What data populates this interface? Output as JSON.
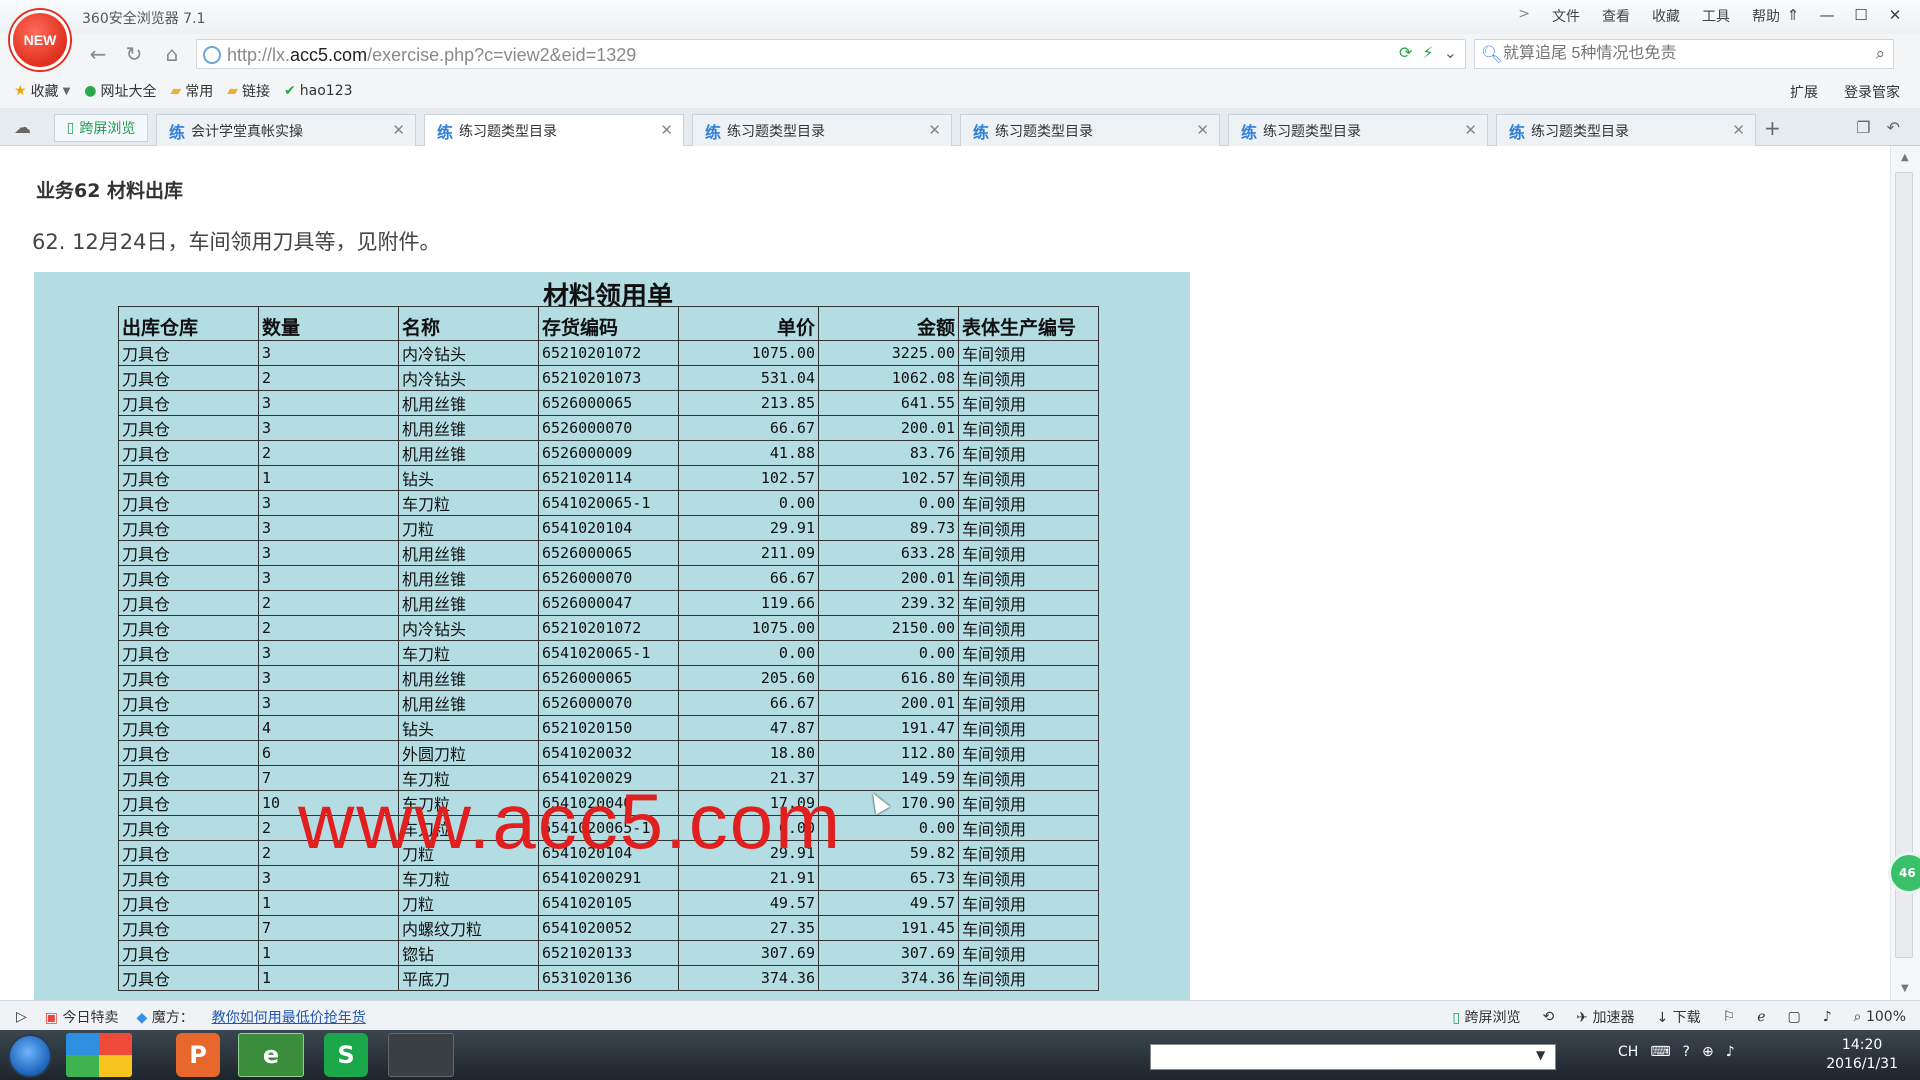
{
  "browser": {
    "logo_text": "NEW",
    "title": "360安全浏览器 7.1",
    "menu": [
      "文件",
      "查看",
      "收藏",
      "工具",
      "帮助"
    ],
    "menu_chevron": ">",
    "window_controls": [
      "⇑",
      "—",
      "☐",
      "✕"
    ],
    "url": {
      "prefix": "http://lx.",
      "host": "acc5.com",
      "path": "/exercise.php?c=view2&eid=1329"
    },
    "search_placeholder": "就算追尾 5种情况也免责",
    "bookmarks": [
      {
        "label": "收藏",
        "icon": "star-icon"
      },
      {
        "label": "网址大全",
        "icon": "globe-icon"
      },
      {
        "label": "常用",
        "icon": "folder-icon"
      },
      {
        "label": "链接",
        "icon": "folder-icon"
      },
      {
        "label": "hao123",
        "icon": "hao123-icon"
      }
    ],
    "bookmarks_right": [
      "扩展",
      "登录管家"
    ],
    "split_label": "跨屏浏览",
    "tabs": [
      {
        "icon": "练",
        "label": "会计学堂真帐实操",
        "active": false
      },
      {
        "icon": "练",
        "label": "练习题类型目录",
        "active": true
      },
      {
        "icon": "练",
        "label": "练习题类型目录",
        "active": false
      },
      {
        "icon": "练",
        "label": "练习题类型目录",
        "active": false
      },
      {
        "icon": "练",
        "label": "练习题类型目录",
        "active": false
      },
      {
        "icon": "练",
        "label": "练习题类型目录",
        "active": false
      }
    ]
  },
  "page": {
    "business_title": "业务62  材料出库",
    "question": "62. 12月24日，车间领用刀具等，见附件。",
    "watermark": "www.acc5.com",
    "form": {
      "title": "材料领用单",
      "headers": [
        "出库仓库",
        "数量",
        "名称",
        "存货编码",
        "单价",
        "金额",
        "表体生产编号"
      ],
      "rows": [
        [
          "刀具仓",
          "3",
          "内冷钻头",
          "65210201072",
          "1075.00",
          "3225.00",
          "车间领用"
        ],
        [
          "刀具仓",
          "2",
          "内冷钻头",
          "65210201073",
          "531.04",
          "1062.08",
          "车间领用"
        ],
        [
          "刀具仓",
          "3",
          "机用丝锥",
          "6526000065",
          "213.85",
          "641.55",
          "车间领用"
        ],
        [
          "刀具仓",
          "3",
          "机用丝锥",
          "6526000070",
          "66.67",
          "200.01",
          "车间领用"
        ],
        [
          "刀具仓",
          "2",
          "机用丝锥",
          "6526000009",
          "41.88",
          "83.76",
          "车间领用"
        ],
        [
          "刀具仓",
          "1",
          "钻头",
          "6521020114",
          "102.57",
          "102.57",
          "车间领用"
        ],
        [
          "刀具仓",
          "3",
          "车刀粒",
          "6541020065-1",
          "0.00",
          "0.00",
          "车间领用"
        ],
        [
          "刀具仓",
          "3",
          "刀粒",
          "6541020104",
          "29.91",
          "89.73",
          "车间领用"
        ],
        [
          "刀具仓",
          "3",
          "机用丝锥",
          "6526000065",
          "211.09",
          "633.28",
          "车间领用"
        ],
        [
          "刀具仓",
          "3",
          "机用丝锥",
          "6526000070",
          "66.67",
          "200.01",
          "车间领用"
        ],
        [
          "刀具仓",
          "2",
          "机用丝锥",
          "6526000047",
          "119.66",
          "239.32",
          "车间领用"
        ],
        [
          "刀具仓",
          "2",
          "内冷钻头",
          "65210201072",
          "1075.00",
          "2150.00",
          "车间领用"
        ],
        [
          "刀具仓",
          "3",
          "车刀粒",
          "6541020065-1",
          "0.00",
          "0.00",
          "车间领用"
        ],
        [
          "刀具仓",
          "3",
          "机用丝锥",
          "6526000065",
          "205.60",
          "616.80",
          "车间领用"
        ],
        [
          "刀具仓",
          "3",
          "机用丝锥",
          "6526000070",
          "66.67",
          "200.01",
          "车间领用"
        ],
        [
          "刀具仓",
          "4",
          "钻头",
          "6521020150",
          "47.87",
          "191.47",
          "车间领用"
        ],
        [
          "刀具仓",
          "6",
          "外圆刀粒",
          "6541020032",
          "18.80",
          "112.80",
          "车间领用"
        ],
        [
          "刀具仓",
          "7",
          "车刀粒",
          "6541020029",
          "21.37",
          "149.59",
          "车间领用"
        ],
        [
          "刀具仓",
          "10",
          "车刀粒",
          "6541020040",
          "17.09",
          "170.90",
          "车间领用"
        ],
        [
          "刀具仓",
          "2",
          "车刀粒",
          "6541020065-1",
          "0.00",
          "0.00",
          "车间领用"
        ],
        [
          "刀具仓",
          "2",
          "刀粒",
          "6541020104",
          "29.91",
          "59.82",
          "车间领用"
        ],
        [
          "刀具仓",
          "3",
          "车刀粒",
          "65410200291",
          "21.91",
          "65.73",
          "车间领用"
        ],
        [
          "刀具仓",
          "1",
          "刀粒",
          "6541020105",
          "49.57",
          "49.57",
          "车间领用"
        ],
        [
          "刀具仓",
          "7",
          "内螺纹刀粒",
          "6541020052",
          "27.35",
          "191.45",
          "车间领用"
        ],
        [
          "刀具仓",
          "1",
          "锪钻",
          "6521020133",
          "307.69",
          "307.69",
          "车间领用"
        ],
        [
          "刀具仓",
          "1",
          "平底刀",
          "6531020136",
          "374.36",
          "374.36",
          "车间领用"
        ]
      ]
    },
    "side_badge": "46"
  },
  "statusbar": {
    "left": [
      "今日特卖",
      "魔方："
    ],
    "link": "教你如何用最低价抢年货",
    "right": [
      "跨屏浏览",
      "加速器",
      "下载"
    ],
    "zoom": "100%"
  },
  "taskbar": {
    "apps": [
      "P",
      "e",
      "S",
      ""
    ],
    "tray_lang": "CH",
    "time": "14:20",
    "date": "2016/1/31"
  }
}
